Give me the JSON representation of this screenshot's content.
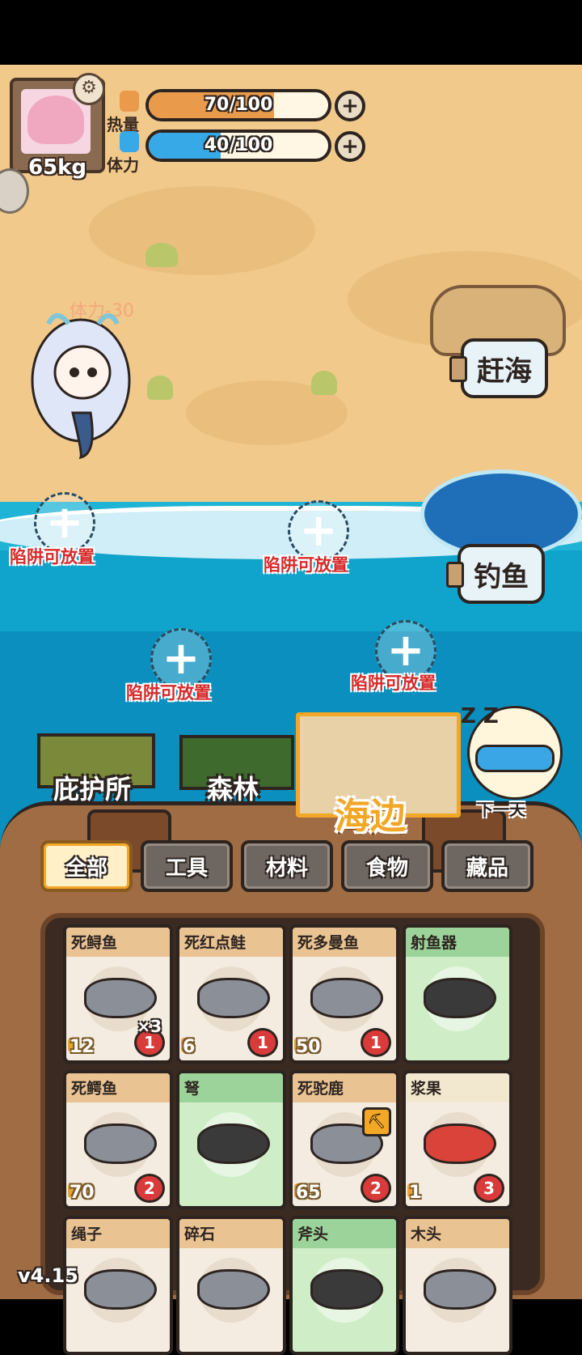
{
  "hud": {
    "weight": "65kg",
    "heat": {
      "label": "热量",
      "value": "70/100",
      "fill": 0.7,
      "color": "#e99a4a"
    },
    "stamina": {
      "label": "体力",
      "value": "40/100",
      "fill": 0.4,
      "color": "#36a9e6"
    },
    "plus": "+",
    "gear": "⚙"
  },
  "floating_text": "体力-30",
  "actions": {
    "gather": "赶海",
    "fish": "钓鱼"
  },
  "traps": [
    {
      "label": "陷阱可放置",
      "icon": "+"
    },
    {
      "label": "陷阱可放置",
      "icon": "+"
    },
    {
      "label": "陷阱可放置",
      "icon": "+"
    },
    {
      "label": "陷阱可放置",
      "icon": "+"
    }
  ],
  "locations": {
    "shelter": "庇护所",
    "forest": "森林",
    "beach": "海边",
    "next_day": "下一天",
    "sleep": "Z Z"
  },
  "tabs": [
    "全部",
    "工具",
    "材料",
    "食物",
    "藏品"
  ],
  "active_tab": "全部",
  "items": [
    {
      "name": "死鲟鱼",
      "calories": "12",
      "spoil": "1",
      "qty": "×3",
      "kind": "food"
    },
    {
      "name": "死红点鲑",
      "calories": "6",
      "spoil": "1",
      "qty": "",
      "kind": "food"
    },
    {
      "name": "死多曼鱼",
      "calories": "50",
      "spoil": "1",
      "qty": "",
      "kind": "food"
    },
    {
      "name": "射鱼器",
      "calories": "",
      "spoil": "",
      "qty": "",
      "kind": "tool"
    },
    {
      "name": "死鳄鱼",
      "calories": "70",
      "spoil": "2",
      "qty": "",
      "kind": "food"
    },
    {
      "name": "弩",
      "calories": "",
      "spoil": "",
      "qty": "",
      "kind": "tool"
    },
    {
      "name": "死驼鹿",
      "calories": "65",
      "spoil": "2",
      "qty": "",
      "kind": "food"
    },
    {
      "name": "浆果",
      "calories": "1",
      "spoil": "3",
      "qty": "",
      "kind": "berry"
    },
    {
      "name": "绳子",
      "calories": "",
      "spoil": "",
      "qty": "",
      "kind": "food"
    },
    {
      "name": "碎石",
      "calories": "",
      "spoil": "",
      "qty": "",
      "kind": "food"
    },
    {
      "name": "斧头",
      "calories": "",
      "spoil": "",
      "qty": "",
      "kind": "tool"
    },
    {
      "name": "木头",
      "calories": "",
      "spoil": "",
      "qty": "",
      "kind": "food"
    }
  ],
  "version": "v4.15",
  "colors": {
    "sand": "#f0c98b",
    "sea": "#0a8fbe",
    "accent": "#f3a726",
    "food_header": "#eac393",
    "tool_header": "#9bd39a",
    "berry_header": "#f2e8cf",
    "spoil_badge": "#d93a3a"
  }
}
